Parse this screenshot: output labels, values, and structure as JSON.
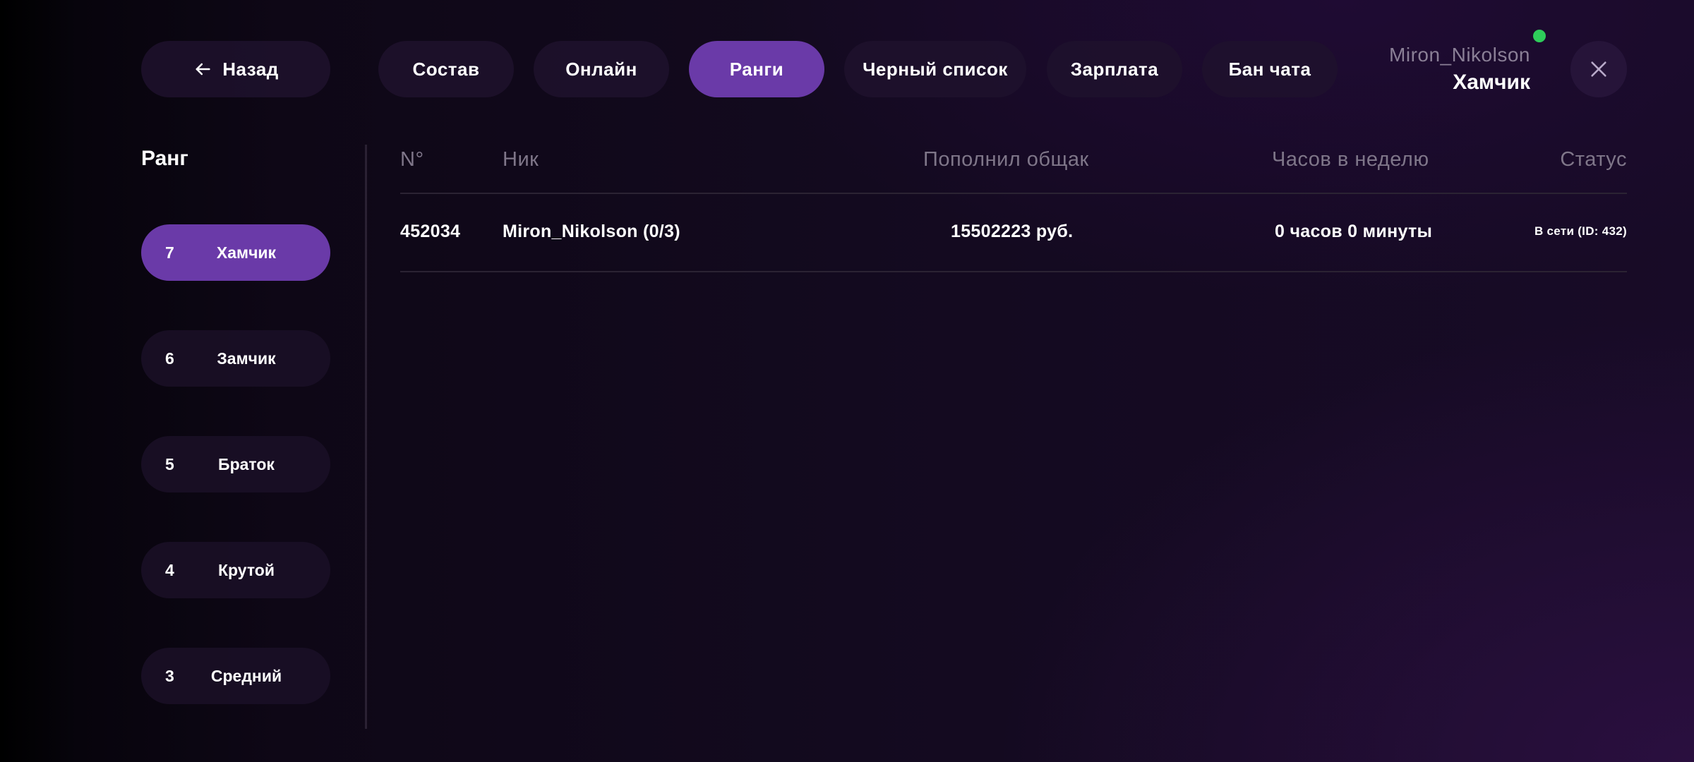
{
  "header": {
    "back_label": "Назад",
    "tabs": [
      {
        "label": "Состав",
        "active": false
      },
      {
        "label": "Онлайн",
        "active": false
      },
      {
        "label": "Ранги",
        "active": true
      },
      {
        "label": "Черный список",
        "active": false
      },
      {
        "label": "Зарплата",
        "active": false
      },
      {
        "label": "Бан чата",
        "active": false
      }
    ],
    "user": {
      "name": "Miron_Nikolson",
      "rank": "Хамчик",
      "online_color": "#2ecc5a"
    }
  },
  "sidebar": {
    "heading": "Ранг",
    "ranks": [
      {
        "num": "7",
        "label": "Хамчик",
        "active": true
      },
      {
        "num": "6",
        "label": "Замчик",
        "active": false
      },
      {
        "num": "5",
        "label": "Браток",
        "active": false
      },
      {
        "num": "4",
        "label": "Крутой",
        "active": false
      },
      {
        "num": "3",
        "label": "Средний",
        "active": false
      }
    ]
  },
  "table": {
    "columns": [
      "N°",
      "Ник",
      "Пополнил общак",
      "Часов в неделю",
      "Статус"
    ],
    "rows": [
      {
        "id": "452034",
        "nick": "Miron_Nikolson (0/3)",
        "deposit": "15502223 руб.",
        "hours": "0 часов 0 минуты",
        "status": "В сети (ID: 432)"
      }
    ]
  },
  "colors": {
    "accent": "#6a3aa8",
    "pill_bg": "#1e122d"
  }
}
